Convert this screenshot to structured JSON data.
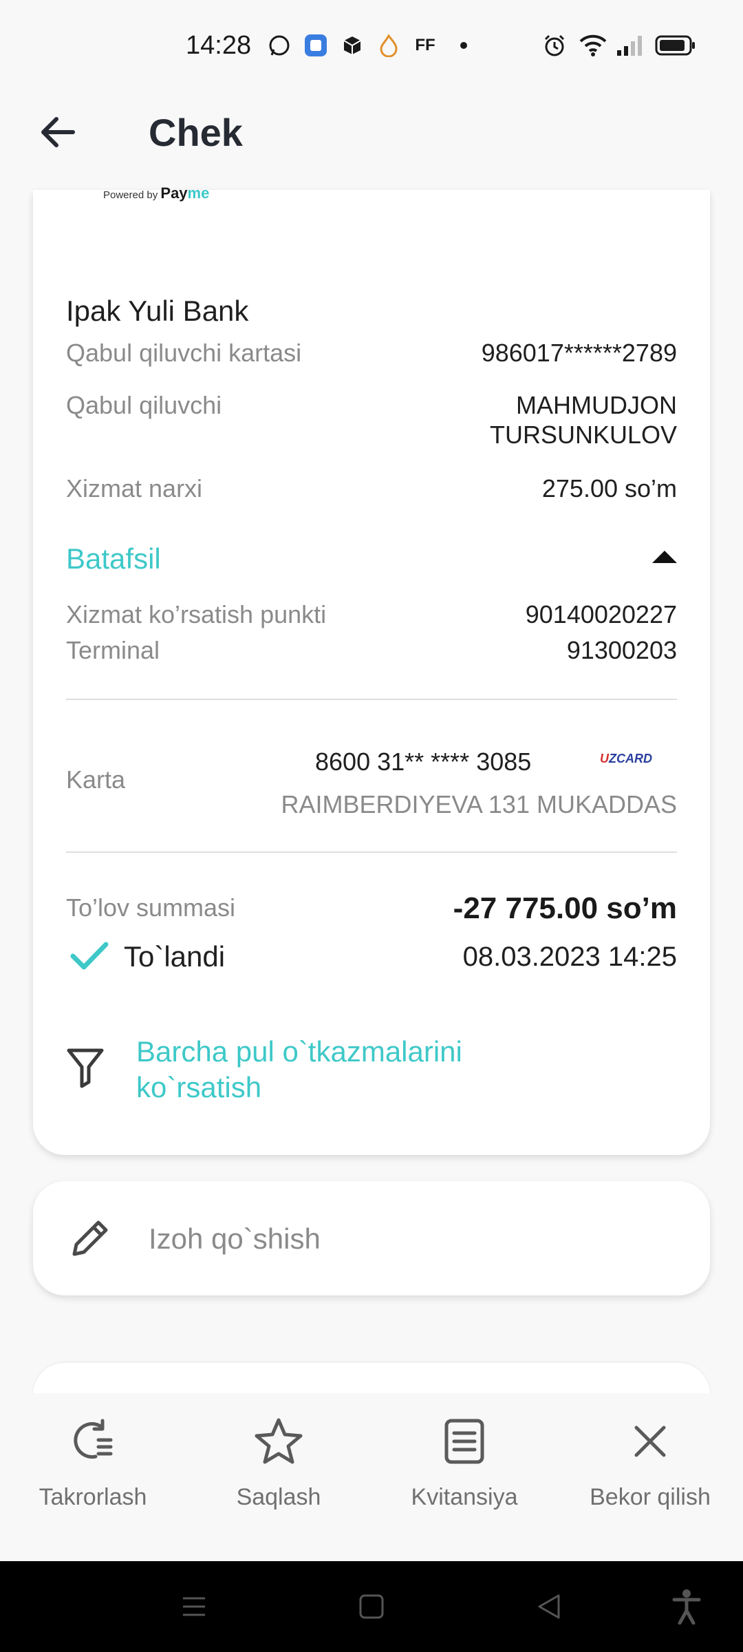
{
  "status_bar": {
    "time": "14:28",
    "notification_text": "FF"
  },
  "header": {
    "title": "Chek"
  },
  "receipt": {
    "powered_prefix": "Powered by",
    "powered_brand_a": "Pay",
    "powered_brand_b": "me",
    "bank_name": "Ipak Yuli Bank",
    "recipient_card_label": "Qabul qiluvchi kartasi",
    "recipient_card_value": "986017******2789",
    "recipient_label": "Qabul qiluvchi",
    "recipient_value_line1": "MAHMUDJON",
    "recipient_value_line2": "TURSUNKULOV",
    "fee_label": "Xizmat narxi",
    "fee_value": "275.00 so’m",
    "details_label": "Batafsil",
    "service_point_label": "Xizmat ko’rsatish punkti",
    "service_point_value": "90140020227",
    "terminal_label": "Terminal",
    "terminal_value": "91300203",
    "card_label": "Karta",
    "card_number": "8600 31** **** 3085",
    "card_brand_a": "U",
    "card_brand_b": "ZCARD",
    "card_holder": "RAIMBERDIYEVA 131 MUKADDAS",
    "amount_label": "To’lov summasi",
    "amount_value": "-27 775.00 so’m",
    "status_label": "To`landi",
    "datetime": "08.03.2023 14:25",
    "show_all_line1": "Barcha pul o`tkazmalarini",
    "show_all_line2": "ko`rsatish"
  },
  "comment": {
    "placeholder": "Izoh qo`shish"
  },
  "actions": [
    {
      "label": "Takrorlash",
      "icon": "repeat-icon"
    },
    {
      "label": "Saqlash",
      "icon": "star-icon"
    },
    {
      "label": "Kvitansiya",
      "icon": "receipt-icon"
    },
    {
      "label": "Bekor qilish",
      "icon": "close-icon"
    }
  ],
  "colors": {
    "accent": "#3ec8c8",
    "background": "#f8f8f8",
    "card": "#ffffff"
  }
}
